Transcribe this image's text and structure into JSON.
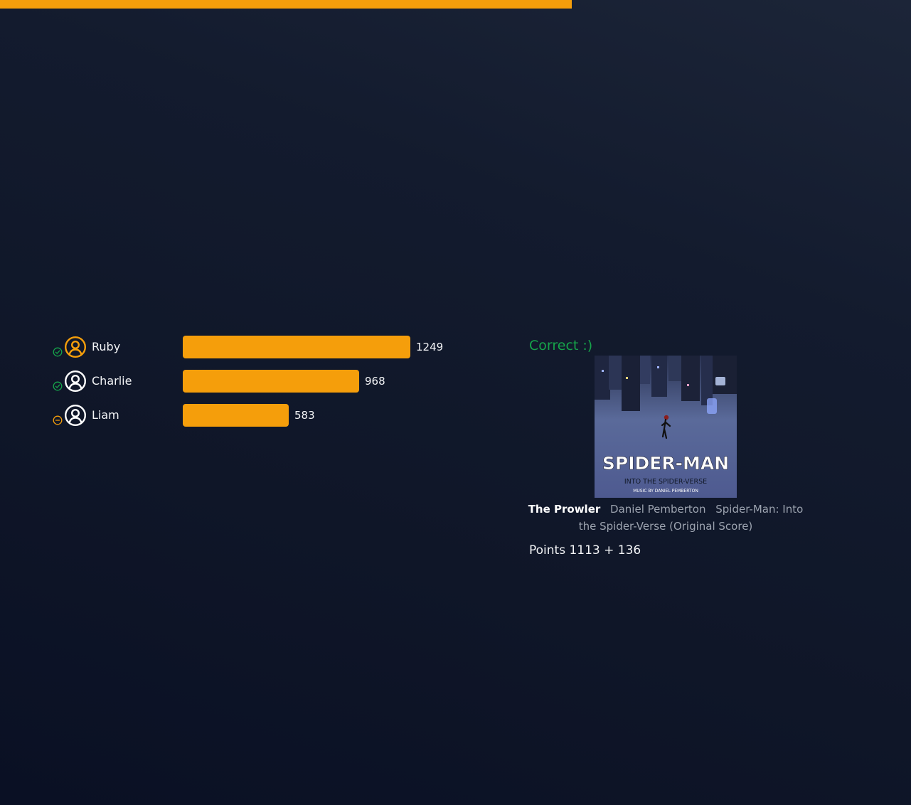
{
  "round_progress": {
    "fraction": 0.628,
    "color": "#f59e0b"
  },
  "scoreboard": {
    "max_score": 1249,
    "bar_color": "#f59e0b",
    "players": [
      {
        "name": "Ruby",
        "score": "1249",
        "status": "correct",
        "status_icon": "check-circle-icon",
        "avatar_icon": "user-circle-icon",
        "avatar_color": "#f59e0b"
      },
      {
        "name": "Charlie",
        "score": "968",
        "status": "correct",
        "status_icon": "check-circle-icon",
        "avatar_icon": "user-circle-icon",
        "avatar_color": "#ffffff"
      },
      {
        "name": "Liam",
        "score": "583",
        "status": "no-answer",
        "status_icon": "minus-circle-icon",
        "avatar_icon": "user-circle-icon",
        "avatar_color": "#ffffff"
      }
    ]
  },
  "result": {
    "label": "Correct :)",
    "color": "#16a34a",
    "album_art": {
      "title_text": "SPIDER-MAN",
      "subtitle_text": "INTO THE SPIDER-VERSE",
      "credit_text": "MUSIC BY DANIEL PEMBERTON"
    },
    "track": {
      "title": "The Prowler",
      "artist": "Daniel Pemberton",
      "album": "Spider-Man: Into the Spider-Verse (Original Score)"
    },
    "points": "Points 1113 + 136"
  },
  "colors": {
    "accent": "#f59e0b",
    "correct": "#16a34a",
    "background": "#111827"
  }
}
